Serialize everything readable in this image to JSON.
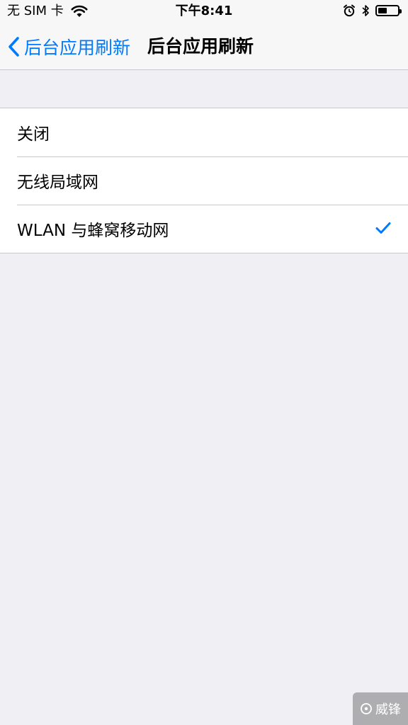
{
  "status_bar": {
    "carrier": "无 SIM 卡",
    "time": "下午8:41",
    "icons": [
      "wifi-icon",
      "alarm-icon",
      "bluetooth-icon",
      "battery-icon"
    ],
    "battery_level": 0.45
  },
  "nav": {
    "back_label": "后台应用刷新",
    "title": "后台应用刷新"
  },
  "options": [
    {
      "label": "关闭",
      "selected": false
    },
    {
      "label": "无线局域网",
      "selected": false
    },
    {
      "label": "WLAN 与蜂窝移动网",
      "selected": true
    }
  ],
  "watermark": {
    "text": "威锋"
  },
  "colors": {
    "accent": "#007aff",
    "background": "#efeff4",
    "separator": "#c8c7cc"
  }
}
